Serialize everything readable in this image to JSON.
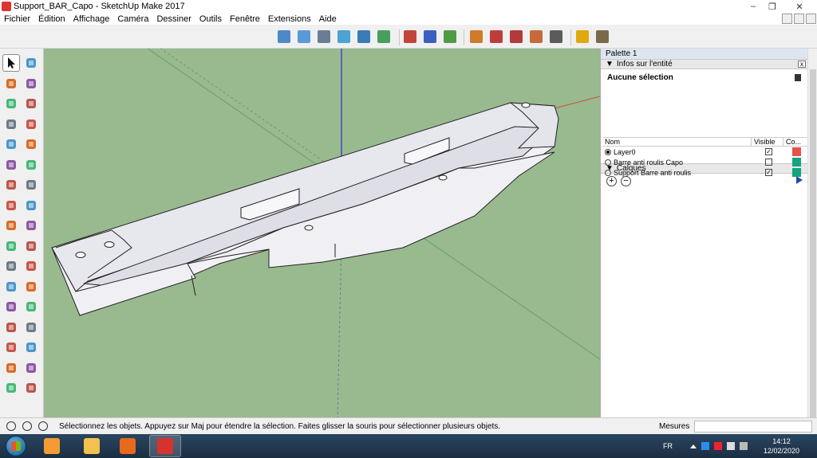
{
  "window": {
    "title": "Support_BAR_Capo - SketchUp Make 2017",
    "minimize": "‒",
    "restore": "❐",
    "close": "✕"
  },
  "menu": [
    "Fichier",
    "Édition",
    "Affichage",
    "Caméra",
    "Dessiner",
    "Outils",
    "Fenêtre",
    "Extensions",
    "Aide"
  ],
  "toolbar": {
    "views": [
      {
        "name": "iso-view-icon",
        "color": "#4c89c6"
      },
      {
        "name": "top-view-icon",
        "color": "#5a9ad8"
      },
      {
        "name": "front-view-icon",
        "color": "#6a7d92"
      },
      {
        "name": "right-view-icon",
        "color": "#4aa3d3"
      },
      {
        "name": "back-view-icon",
        "color": "#3b7bb8"
      },
      {
        "name": "left-view-icon",
        "color": "#46a05c"
      }
    ],
    "modify": [
      {
        "name": "sandbox-from-contours-icon",
        "color": "#c0453a"
      },
      {
        "name": "sandbox-from-scratch-icon",
        "color": "#3b5ec0"
      },
      {
        "name": "sandbox-smoove-icon",
        "color": "#4f9b45"
      }
    ],
    "sandbox": [
      {
        "name": "stamp-icon",
        "color": "#d07a2a"
      },
      {
        "name": "drape-icon",
        "color": "#c03c3c"
      },
      {
        "name": "add-detail-icon",
        "color": "#b33a3a"
      },
      {
        "name": "flip-edge-icon",
        "color": "#c76a3a"
      },
      {
        "name": "sandbox-extra-icon",
        "color": "#5b5b5b"
      }
    ],
    "extras": [
      {
        "name": "geo-location-icon",
        "color": "#e0a90f"
      },
      {
        "name": "extension-warehouse-icon",
        "color": "#7a6a4a"
      }
    ]
  },
  "left_tools": [
    [
      "select-icon",
      "component-icon"
    ],
    [
      "paint-bucket-icon",
      "eraser-icon"
    ],
    [
      "line-icon",
      "freehand-icon"
    ],
    [
      "rectangle-icon",
      "rotated-rectangle-icon"
    ],
    [
      "circle-icon",
      "polygon-icon"
    ],
    [
      "arc-icon",
      "two-point-arc-icon"
    ],
    [
      "three-point-arc-icon",
      "pie-icon"
    ],
    [
      "move-icon",
      "push-pull-icon"
    ],
    [
      "rotate-icon",
      "follow-me-icon"
    ],
    [
      "scale-icon",
      "offset-icon"
    ],
    [
      "tape-measure-icon",
      "dimension-icon"
    ],
    [
      "protractor-icon",
      "text-icon"
    ],
    [
      "axes-icon",
      "3d-text-icon"
    ],
    [
      "orbit-icon",
      "pan-icon"
    ],
    [
      "zoom-icon",
      "zoom-window-icon"
    ],
    [
      "zoom-extents-icon",
      "position-camera-icon"
    ],
    [
      "walk-icon",
      "look-around-icon"
    ]
  ],
  "panel": {
    "title": "Palette 1",
    "entity_info": {
      "header": "Infos sur l'entité",
      "selection": "Aucune sélection"
    },
    "layers": {
      "header": "Calques",
      "columns": [
        "Nom",
        "Visible",
        "Co..."
      ],
      "rows": [
        {
          "name": "Layer0",
          "active": true,
          "visible": true,
          "color": "#e8524a"
        },
        {
          "name": "Barre anti roulis Capo",
          "active": false,
          "visible": false,
          "color": "#13a37f"
        },
        {
          "name": "Support Barre anti roulis",
          "active": false,
          "visible": true,
          "color": "#13a37f"
        }
      ]
    }
  },
  "status": {
    "text": "Sélectionnez les objets. Appuyez sur Maj pour étendre la sélection. Faites glisser la souris pour sélectionner plusieurs objets.",
    "measures_label": "Mesures",
    "measures_value": ""
  },
  "taskbar": {
    "apps": [
      {
        "name": "media-player-icon",
        "color": "#f39c35"
      },
      {
        "name": "file-explorer-icon",
        "color": "#f2c14e"
      },
      {
        "name": "firefox-icon",
        "color": "#e66a1c"
      },
      {
        "name": "sketchup-icon",
        "color": "#d8322e"
      }
    ],
    "lang": "FR",
    "time": "14:12",
    "date": "12/02/2020"
  },
  "colors": {
    "sky": "#99b98f",
    "model_top": "#e9e9ef",
    "model_side": "#f5f5f8",
    "axis_red": "#c8503c",
    "axis_green": "#3d8f3d",
    "axis_blue": "#2b3ec8"
  }
}
